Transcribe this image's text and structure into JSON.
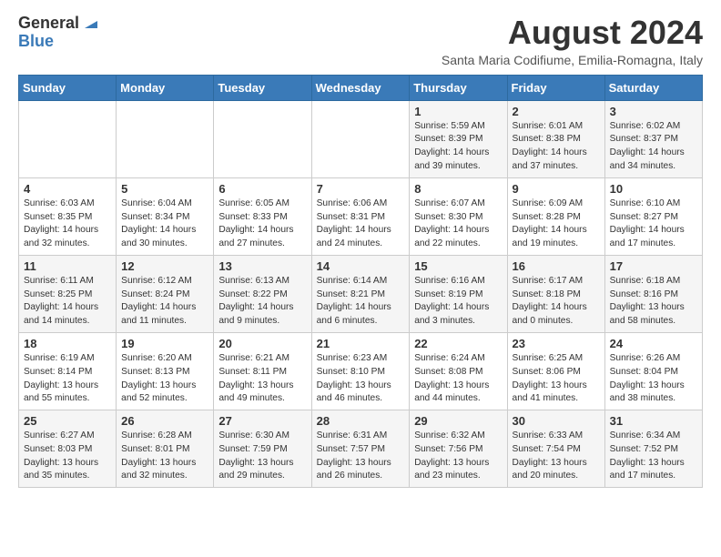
{
  "header": {
    "logo_general": "General",
    "logo_blue": "Blue",
    "main_title": "August 2024",
    "subtitle": "Santa Maria Codifiume, Emilia-Romagna, Italy"
  },
  "columns": [
    "Sunday",
    "Monday",
    "Tuesday",
    "Wednesday",
    "Thursday",
    "Friday",
    "Saturday"
  ],
  "rows": [
    [
      {
        "day": "",
        "info": ""
      },
      {
        "day": "",
        "info": ""
      },
      {
        "day": "",
        "info": ""
      },
      {
        "day": "",
        "info": ""
      },
      {
        "day": "1",
        "info": "Sunrise: 5:59 AM\nSunset: 8:39 PM\nDaylight: 14 hours\nand 39 minutes."
      },
      {
        "day": "2",
        "info": "Sunrise: 6:01 AM\nSunset: 8:38 PM\nDaylight: 14 hours\nand 37 minutes."
      },
      {
        "day": "3",
        "info": "Sunrise: 6:02 AM\nSunset: 8:37 PM\nDaylight: 14 hours\nand 34 minutes."
      }
    ],
    [
      {
        "day": "4",
        "info": "Sunrise: 6:03 AM\nSunset: 8:35 PM\nDaylight: 14 hours\nand 32 minutes."
      },
      {
        "day": "5",
        "info": "Sunrise: 6:04 AM\nSunset: 8:34 PM\nDaylight: 14 hours\nand 30 minutes."
      },
      {
        "day": "6",
        "info": "Sunrise: 6:05 AM\nSunset: 8:33 PM\nDaylight: 14 hours\nand 27 minutes."
      },
      {
        "day": "7",
        "info": "Sunrise: 6:06 AM\nSunset: 8:31 PM\nDaylight: 14 hours\nand 24 minutes."
      },
      {
        "day": "8",
        "info": "Sunrise: 6:07 AM\nSunset: 8:30 PM\nDaylight: 14 hours\nand 22 minutes."
      },
      {
        "day": "9",
        "info": "Sunrise: 6:09 AM\nSunset: 8:28 PM\nDaylight: 14 hours\nand 19 minutes."
      },
      {
        "day": "10",
        "info": "Sunrise: 6:10 AM\nSunset: 8:27 PM\nDaylight: 14 hours\nand 17 minutes."
      }
    ],
    [
      {
        "day": "11",
        "info": "Sunrise: 6:11 AM\nSunset: 8:25 PM\nDaylight: 14 hours\nand 14 minutes."
      },
      {
        "day": "12",
        "info": "Sunrise: 6:12 AM\nSunset: 8:24 PM\nDaylight: 14 hours\nand 11 minutes."
      },
      {
        "day": "13",
        "info": "Sunrise: 6:13 AM\nSunset: 8:22 PM\nDaylight: 14 hours\nand 9 minutes."
      },
      {
        "day": "14",
        "info": "Sunrise: 6:14 AM\nSunset: 8:21 PM\nDaylight: 14 hours\nand 6 minutes."
      },
      {
        "day": "15",
        "info": "Sunrise: 6:16 AM\nSunset: 8:19 PM\nDaylight: 14 hours\nand 3 minutes."
      },
      {
        "day": "16",
        "info": "Sunrise: 6:17 AM\nSunset: 8:18 PM\nDaylight: 14 hours\nand 0 minutes."
      },
      {
        "day": "17",
        "info": "Sunrise: 6:18 AM\nSunset: 8:16 PM\nDaylight: 13 hours\nand 58 minutes."
      }
    ],
    [
      {
        "day": "18",
        "info": "Sunrise: 6:19 AM\nSunset: 8:14 PM\nDaylight: 13 hours\nand 55 minutes."
      },
      {
        "day": "19",
        "info": "Sunrise: 6:20 AM\nSunset: 8:13 PM\nDaylight: 13 hours\nand 52 minutes."
      },
      {
        "day": "20",
        "info": "Sunrise: 6:21 AM\nSunset: 8:11 PM\nDaylight: 13 hours\nand 49 minutes."
      },
      {
        "day": "21",
        "info": "Sunrise: 6:23 AM\nSunset: 8:10 PM\nDaylight: 13 hours\nand 46 minutes."
      },
      {
        "day": "22",
        "info": "Sunrise: 6:24 AM\nSunset: 8:08 PM\nDaylight: 13 hours\nand 44 minutes."
      },
      {
        "day": "23",
        "info": "Sunrise: 6:25 AM\nSunset: 8:06 PM\nDaylight: 13 hours\nand 41 minutes."
      },
      {
        "day": "24",
        "info": "Sunrise: 6:26 AM\nSunset: 8:04 PM\nDaylight: 13 hours\nand 38 minutes."
      }
    ],
    [
      {
        "day": "25",
        "info": "Sunrise: 6:27 AM\nSunset: 8:03 PM\nDaylight: 13 hours\nand 35 minutes."
      },
      {
        "day": "26",
        "info": "Sunrise: 6:28 AM\nSunset: 8:01 PM\nDaylight: 13 hours\nand 32 minutes."
      },
      {
        "day": "27",
        "info": "Sunrise: 6:30 AM\nSunset: 7:59 PM\nDaylight: 13 hours\nand 29 minutes."
      },
      {
        "day": "28",
        "info": "Sunrise: 6:31 AM\nSunset: 7:57 PM\nDaylight: 13 hours\nand 26 minutes."
      },
      {
        "day": "29",
        "info": "Sunrise: 6:32 AM\nSunset: 7:56 PM\nDaylight: 13 hours\nand 23 minutes."
      },
      {
        "day": "30",
        "info": "Sunrise: 6:33 AM\nSunset: 7:54 PM\nDaylight: 13 hours\nand 20 minutes."
      },
      {
        "day": "31",
        "info": "Sunrise: 6:34 AM\nSunset: 7:52 PM\nDaylight: 13 hours\nand 17 minutes."
      }
    ]
  ]
}
